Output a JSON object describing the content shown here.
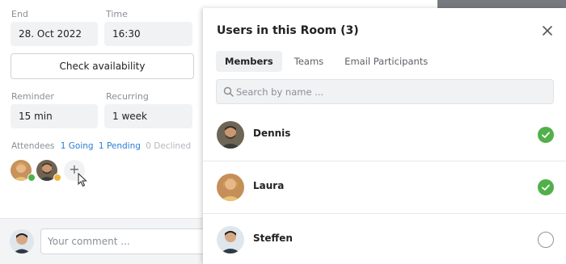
{
  "form": {
    "end_label": "End",
    "end_value": "28. Oct 2022",
    "time_label": "Time",
    "time_value": "16:30",
    "check_availability_label": "Check availability",
    "reminder_label": "Reminder",
    "reminder_value": "15 min",
    "recurring_label": "Recurring",
    "recurring_value": "1 week",
    "attendees_label": "Attendees",
    "going": "1 Going",
    "pending": "1 Pending",
    "declined": "0 Declined",
    "add_symbol": "+"
  },
  "comment": {
    "placeholder": "Your comment ..."
  },
  "modal": {
    "title": "Users in this Room (3)",
    "tabs": [
      {
        "label": "Members",
        "active": true
      },
      {
        "label": "Teams",
        "active": false
      },
      {
        "label": "Email Participants",
        "active": false
      }
    ],
    "search_placeholder": "Search by name ...",
    "users": [
      {
        "name": "Dennis",
        "selected": true
      },
      {
        "name": "Laura",
        "selected": true
      },
      {
        "name": "Steffen",
        "selected": false
      }
    ]
  },
  "colors": {
    "accent_link": "#2a7fd4",
    "selected_green": "#52b04a",
    "pending_orange": "#f0b23c"
  },
  "icons": {
    "close": "close-icon",
    "search": "search-icon",
    "check": "check-icon",
    "cursor": "mouse-pointer-icon"
  }
}
